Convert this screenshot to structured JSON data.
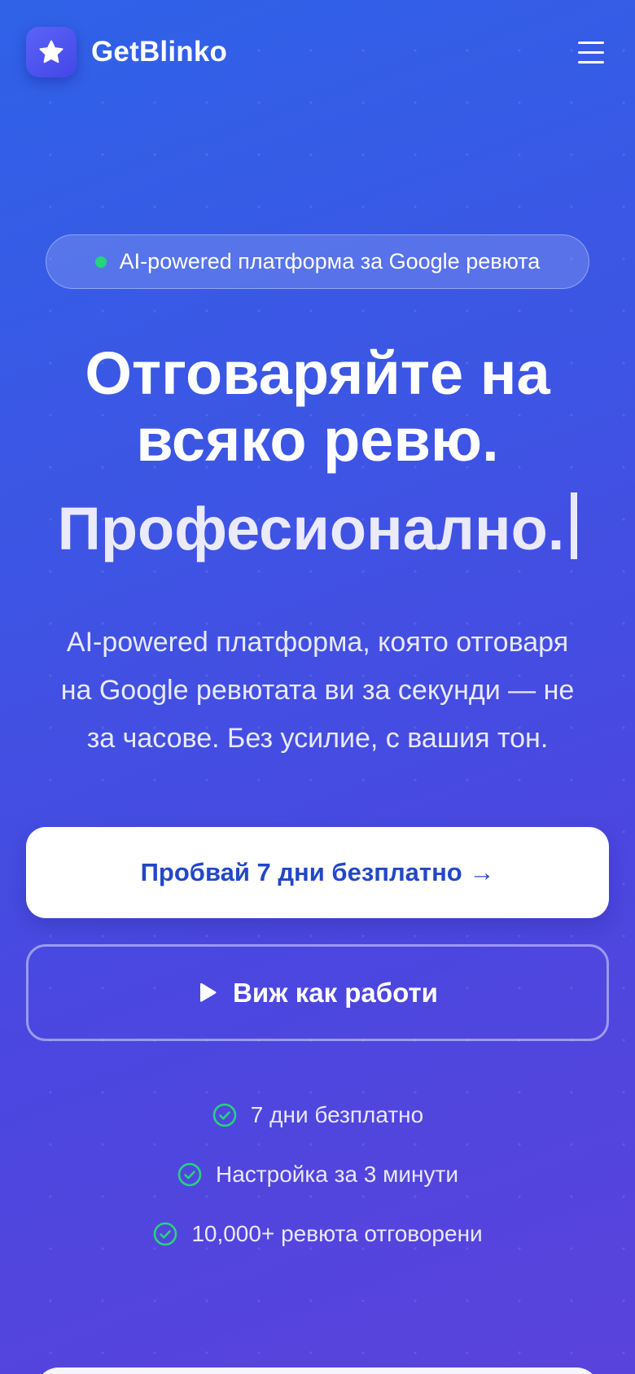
{
  "header": {
    "brand_name": "GetBlinko",
    "logo_icon": "star-icon",
    "menu_icon": "hamburger-menu-icon"
  },
  "badge": {
    "text": "AI-powered платформа за Google ревюта",
    "dot_color": "#27d37b"
  },
  "hero": {
    "headline_line1": "Отговаряйте на",
    "headline_line2": "всяко ревю.",
    "headline_line3": "Професионално.",
    "subtitle_line1": "AI-powered платформа, която отговаря",
    "subtitle_line2": "на Google ревютата ви за секунди — не",
    "subtitle_line3": "за часове. Без усилие, с вашия тон."
  },
  "cta": {
    "primary_label": "Пробвай 7 дни безплатно →",
    "secondary_label": "Виж как работи",
    "secondary_icon": "play-icon"
  },
  "features": [
    {
      "label": "7 дни безплатно",
      "icon": "check-circle-icon"
    },
    {
      "label": "Настройка за 3 минути",
      "icon": "check-circle-icon"
    },
    {
      "label": "10,000+ ревюта отговорени",
      "icon": "check-circle-icon"
    }
  ],
  "colors": {
    "accent_blue": "#2347c8",
    "check_green": "#27d37b"
  }
}
